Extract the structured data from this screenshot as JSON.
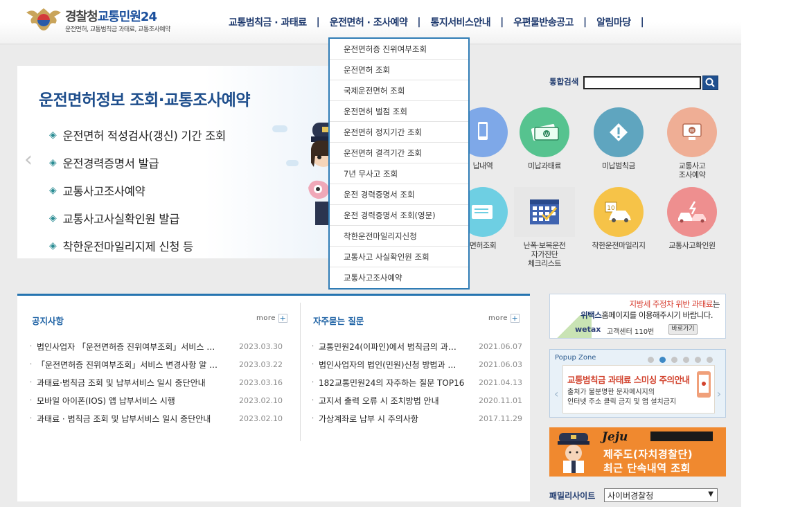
{
  "header": {
    "org_gray": "경찰청",
    "org_blue": "교통민원24",
    "subtitle": "운전면허, 교통범칙금 과태료, 교통조사예약",
    "nav": [
      "교통범칙금 · 과태료",
      "운전면허 · 조사예약",
      "통지서비스안내",
      "우편물반송공고",
      "알림마당"
    ],
    "nav_sep": "|"
  },
  "dropdown": {
    "items": [
      "운전면허증 진위여부조회",
      "운전면허 조회",
      "국제운전면허 조회",
      "운전면허 벌점 조회",
      "운전면허 정지기간 조회",
      "운전면허 결격기간 조회",
      "7년 무사고 조회",
      "운전 경력증명서 조회",
      "운전 경력증명서 조회(영문)",
      "착한운전마일리지신청",
      "교통사고 사실확인원 조회",
      "교통사고조사예약"
    ]
  },
  "hero": {
    "title": "운전면허정보 조회·교통조사예약",
    "bullet": "◈",
    "items": [
      "운전면허 적성검사(갱신) 기간 조회",
      "운전경력증명서 발급",
      "교통사고조사예약",
      "교통사고사실확인원 발급",
      "착한운전마일리지제 신청 등"
    ],
    "prev": "‹"
  },
  "search": {
    "label": "통합검색",
    "value": ""
  },
  "quick_menu": [
    {
      "label": "납내역",
      "color": "#7ea8e8",
      "icon": "mobile-icon"
    },
    {
      "label": "미납과태료",
      "color": "#56c38f",
      "icon": "money-icon"
    },
    {
      "label": "미납범칙금",
      "color": "#5fa5bf",
      "icon": "warning-icon"
    },
    {
      "label": "교통사고\n조사예약",
      "color": "#efae95",
      "icon": "monitor-icon"
    },
    {
      "label": "면허조회",
      "color": "#6ecfe3",
      "icon": "card-icon"
    },
    {
      "label": "난폭·보복운전\n자가진단\n체크리스트",
      "color": "#e7e7e7",
      "icon": "calendar-icon"
    },
    {
      "label": "착한운전마일리지",
      "color": "#f6c348",
      "icon": "car-icon"
    },
    {
      "label": "교통사고확인원",
      "color": "#ee8f8f",
      "icon": "crash-icon"
    }
  ],
  "notices": {
    "title": "공지사항",
    "more": "more",
    "items": [
      {
        "title": "법인사업자 「운전면허증 진위여부조회」서비스 …",
        "date": "2023.03.30"
      },
      {
        "title": "「운전면허증 진위여부조회」서비스 변경사항 알 …",
        "date": "2023.03.22"
      },
      {
        "title": "과태료·범칙금 조회 및 납부서비스 일시 중단안내",
        "date": "2023.03.16"
      },
      {
        "title": "모바일 아이폰(IOS) 앱 납부서비스 시행",
        "date": "2023.02.10"
      },
      {
        "title": "과태료 · 범칙금 조회 및 납부서비스 일시 중단안내",
        "date": "2023.02.10"
      }
    ]
  },
  "faq": {
    "title": "자주묻는 질문",
    "more": "more",
    "items": [
      {
        "title": "교통민원24(이파인)에서 범칙금의 과…",
        "date": "2021.06.07"
      },
      {
        "title": "법인사업자의 법인(민원)신청 방법과 …",
        "date": "2021.06.03"
      },
      {
        "title": "182교통민원24의 자주하는 질문 TOP16",
        "date": "2021.04.13"
      },
      {
        "title": "고지서 출력 오류 시 조치방법 안내",
        "date": "2020.11.01"
      },
      {
        "title": "가상계좌로 납부 시 주의사항",
        "date": "2017.11.29"
      }
    ]
  },
  "banner_wetax": {
    "line1_red": "지방세 주정차 위반 과태료",
    "line1_rest": "는",
    "line2_bold": "위택스",
    "line2_rest": "홈페이지를 이용해주시기 바랍니다.",
    "logo": "wetax",
    "center": "고객센터 110번",
    "go": "바로가기"
  },
  "popup_zone": {
    "title": "Popup Zone",
    "active_index": 1,
    "dot_count": 6,
    "headline": "교통범칙금 과태료 스미싱 주의안내",
    "text_line1": "출처가 불분명한 문자메시지의",
    "text_line2": "인터넷 주소 클릭 금지 및 앱 설치금지",
    "prev": "‹",
    "next": "›"
  },
  "banner_jeju": {
    "brand": "Jeju",
    "line1": "제주도(자치경찰단)",
    "line2": "최근 단속내역 조회"
  },
  "family_site": {
    "label": "패밀리사이트",
    "selected": "사이버경찰청",
    "arrow": "▼"
  }
}
